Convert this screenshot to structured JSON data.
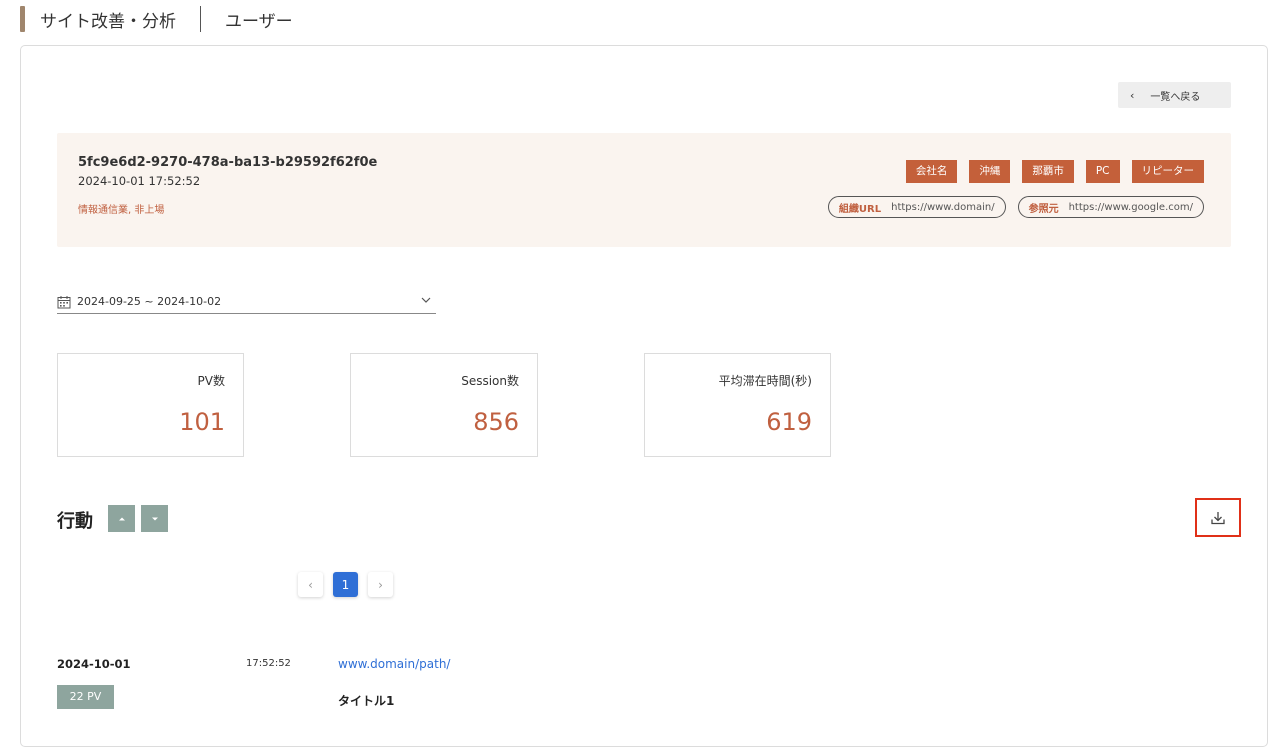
{
  "header": {
    "title": "サイト改善・分析",
    "subtitle": "ユーザー"
  },
  "back_button": {
    "label": "一覧へ戻る"
  },
  "profile": {
    "user_id": "5fc9e6d2-9270-478a-ba13-b29592f62f0e",
    "timestamp": "2024-10-01 17:52:52",
    "industry": "情報通信業, 非上場",
    "tags": [
      "会社名",
      "沖縄",
      "那覇市",
      "PC",
      "リピーター"
    ],
    "links": [
      {
        "label": "組織URL",
        "value": "https://www.domain/"
      },
      {
        "label": "参照元",
        "value": "https://www.google.com/"
      }
    ]
  },
  "date_range": {
    "value": "2024-09-25 ~ 2024-10-02"
  },
  "stats": [
    {
      "label": "PV数",
      "value": "101"
    },
    {
      "label": "Session数",
      "value": "856"
    },
    {
      "label": "平均滞在時間(秒)",
      "value": "619"
    }
  ],
  "behavior": {
    "title": "行動",
    "pagination": {
      "current": "1",
      "prev": "‹",
      "next": "›"
    },
    "logs": [
      {
        "date": "2024-10-01",
        "time": "17:52:52",
        "url": "www.domain/path/",
        "pv": "22 PV",
        "title": "タイトル1"
      }
    ]
  },
  "colors": {
    "accent": "#c4603a",
    "sort_button": "#8ea59e",
    "highlight": "#e03018",
    "link": "#2f6fd6"
  }
}
